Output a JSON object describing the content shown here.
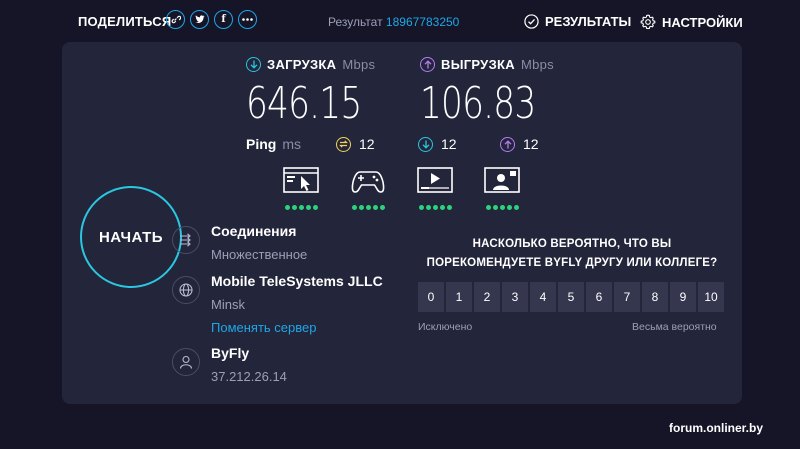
{
  "header": {
    "share_label": "ПОДЕЛИТЬСЯ",
    "share_icons": [
      "link-icon",
      "twitter-icon",
      "facebook-icon",
      "more-icon"
    ],
    "result_label": "Результат",
    "result_id": "18967783250",
    "results_label": "РЕЗУЛЬТАТЫ",
    "settings_label": "НАСТРОЙКИ"
  },
  "download": {
    "label": "ЗАГРУЗКА",
    "unit": "Mbps",
    "value": "646.15",
    "color": "#2bc6e0"
  },
  "upload": {
    "label": "ВЫГРУЗКА",
    "unit": "Mbps",
    "value": "106.83",
    "color": "#b57cf2"
  },
  "ping": {
    "label": "Ping",
    "unit": "ms",
    "idle": "12",
    "download": "12",
    "upload": "12",
    "idle_color": "#f2d45c",
    "download_color": "#2bc6e0",
    "upload_color": "#b57cf2"
  },
  "activities": [
    {
      "icon": "web-browsing-icon",
      "level": 5
    },
    {
      "icon": "gaming-icon",
      "level": 5
    },
    {
      "icon": "video-streaming-icon",
      "level": 5
    },
    {
      "icon": "video-chat-icon",
      "level": 5
    }
  ],
  "start_label": "НАЧАТЬ",
  "connections": {
    "title": "Соединения",
    "value": "Множественное"
  },
  "server": {
    "name": "Mobile TeleSystems JLLC",
    "city": "Minsk",
    "change_label": "Поменять сервер"
  },
  "provider": {
    "name": "ByFly",
    "ip": "37.212.26.14"
  },
  "survey": {
    "question_line1": "НАСКОЛЬКО ВЕРОЯТНО, ЧТО ВЫ",
    "question_line2": "ПОРЕКОМЕНДУЕТЕ BYFLY ДРУГУ ИЛИ КОЛЛЕГЕ?",
    "scale": [
      "0",
      "1",
      "2",
      "3",
      "4",
      "5",
      "6",
      "7",
      "8",
      "9",
      "10"
    ],
    "low_label": "Исключено",
    "high_label": "Весьма вероятно"
  },
  "watermark": "forum.onliner.by",
  "colors": {
    "accent": "#1ea7e8",
    "panel": "#23253a",
    "background": "#151527",
    "good": "#2bd37a"
  }
}
